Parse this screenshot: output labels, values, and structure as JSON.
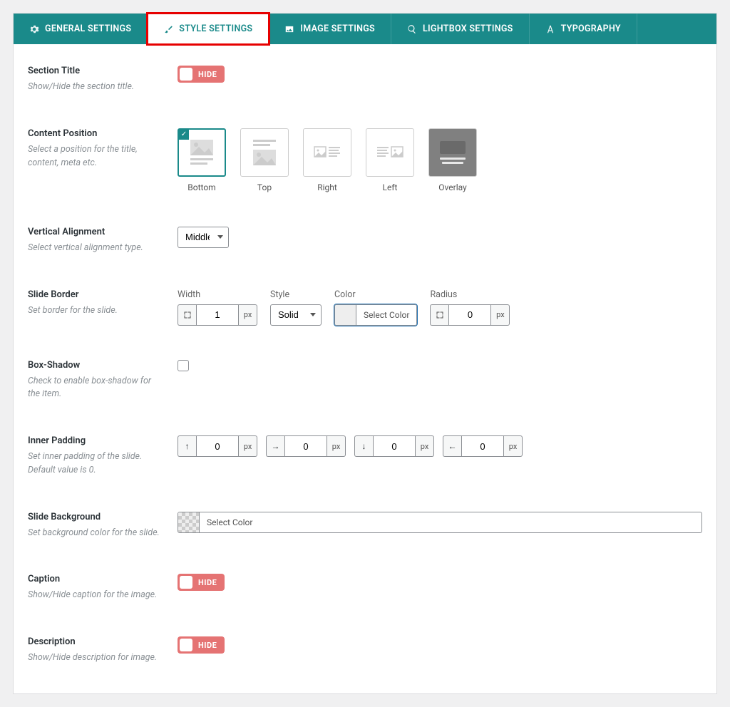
{
  "tabs": [
    {
      "label": "GENERAL SETTINGS"
    },
    {
      "label": "STYLE SETTINGS"
    },
    {
      "label": "IMAGE SETTINGS"
    },
    {
      "label": "LIGHTBOX SETTINGS"
    },
    {
      "label": "TYPOGRAPHY"
    }
  ],
  "sectionTitle": {
    "title": "Section Title",
    "desc": "Show/Hide the section title.",
    "toggle": "HIDE"
  },
  "contentPosition": {
    "title": "Content Position",
    "desc": "Select a position for the title, content, meta etc.",
    "options": [
      "Bottom",
      "Top",
      "Right",
      "Left",
      "Overlay"
    ]
  },
  "verticalAlign": {
    "title": "Vertical Alignment",
    "desc": "Select vertical alignment type.",
    "value": "Middle"
  },
  "slideBorder": {
    "title": "Slide Border",
    "desc": "Set border for the slide.",
    "widthLabel": "Width",
    "widthVal": "1",
    "widthUnit": "px",
    "styleLabel": "Style",
    "styleVal": "Solid",
    "colorLabel": "Color",
    "colorBtn": "Select Color",
    "radiusLabel": "Radius",
    "radiusVal": "0",
    "radiusUnit": "px"
  },
  "boxShadow": {
    "title": "Box-Shadow",
    "desc": "Check to enable box-shadow for the item."
  },
  "innerPadding": {
    "title": "Inner Padding",
    "desc": "Set inner padding of the slide. Default value is 0.",
    "top": "0",
    "right": "0",
    "bottom": "0",
    "left": "0",
    "unit": "px"
  },
  "slideBg": {
    "title": "Slide Background",
    "desc": "Set background color for the slide.",
    "btn": "Select Color"
  },
  "caption": {
    "title": "Caption",
    "desc": "Show/Hide caption for the image.",
    "toggle": "HIDE"
  },
  "description": {
    "title": "Description",
    "desc": "Show/Hide description for image.",
    "toggle": "HIDE"
  }
}
